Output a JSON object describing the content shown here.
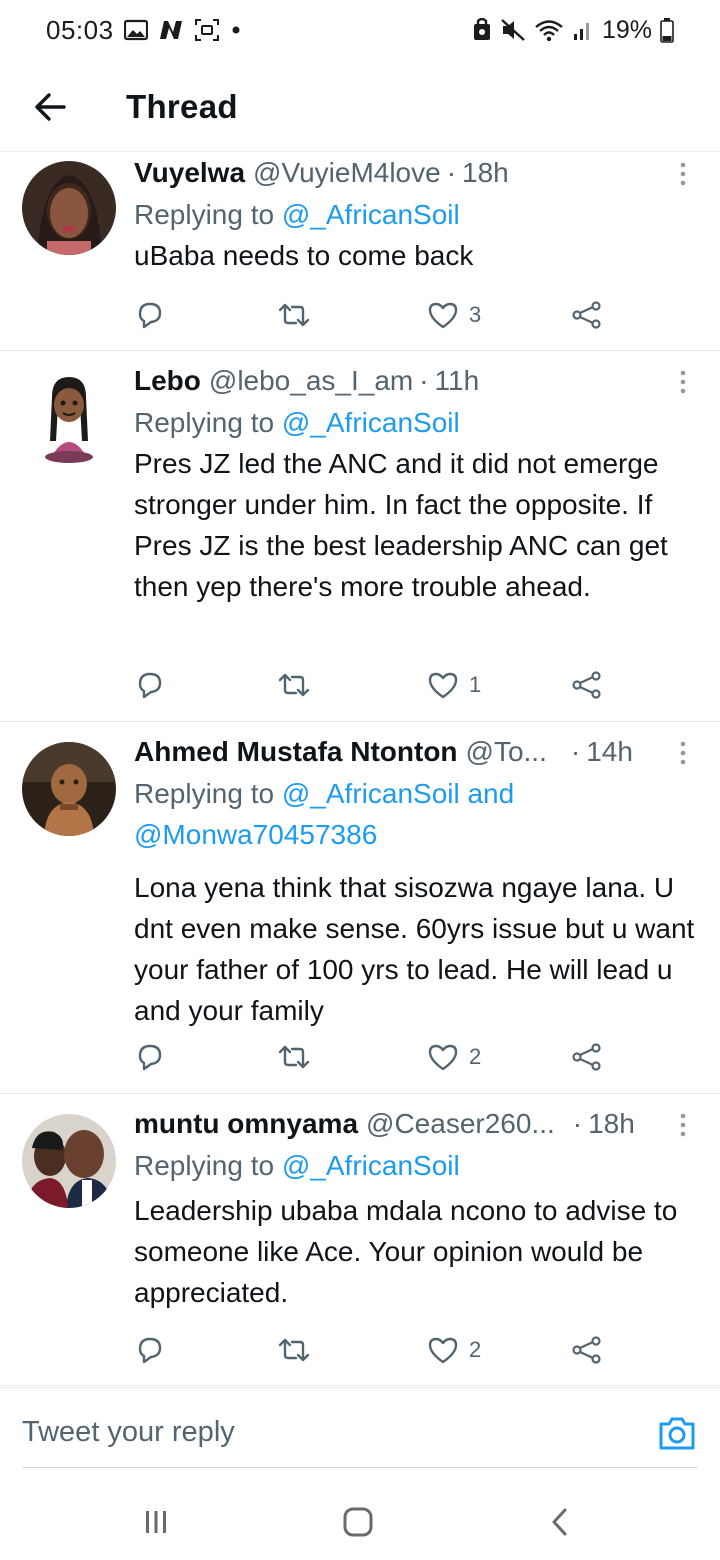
{
  "status_bar": {
    "time": "05:03",
    "battery": "19%"
  },
  "header": {
    "title": "Thread"
  },
  "tweets": [
    {
      "name": "Vuyelwa",
      "handle": "@VuyieM4love",
      "time": "18h",
      "replying_prefix": "Replying to ",
      "replying_to": "@_AfricanSoil",
      "text": "uBaba needs to come back",
      "likes": "3"
    },
    {
      "name": "Lebo",
      "handle": "@lebo_as_I_am",
      "time": "11h",
      "replying_prefix": "Replying to ",
      "replying_to": "@_AfricanSoil",
      "text": "Pres JZ led the ANC and it did not emerge stronger under him. In fact the opposite. If Pres JZ is the best leadership ANC can get then yep there's more trouble ahead.",
      "likes": "1"
    },
    {
      "name": "Ahmed Mustafa Ntonton",
      "handle": "@To...",
      "time": "14h",
      "replying_prefix": "Replying to ",
      "replying_to": "@_AfricanSoil and @Monwa70457386",
      "text": "Lona yena think that sisozwa ngaye lana. U dnt even make sense. 60yrs issue but u want your father of 100 yrs to lead. He will lead u and your family",
      "likes": "2"
    },
    {
      "name": "muntu omnyama",
      "handle": "@Ceaser260...",
      "time": "18h",
      "replying_prefix": "Replying to ",
      "replying_to": "@_AfricanSoil",
      "text": "Leadership ubaba mdala ncono to advise to someone like Ace. Your opinion would be appreciated.",
      "likes": "2"
    }
  ],
  "reply_bar": {
    "placeholder": "Tweet your reply"
  },
  "colors": {
    "link": "#1d9bf0",
    "secondary_text": "#536471",
    "primary_text": "#0f1419"
  }
}
